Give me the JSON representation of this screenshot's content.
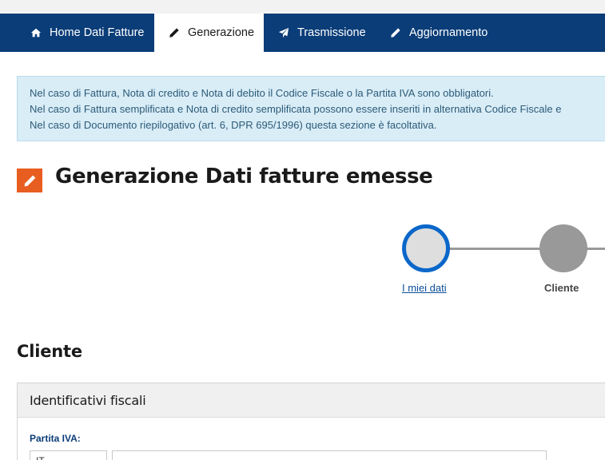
{
  "nav": {
    "tabs": [
      {
        "label": "Home Dati Fatture",
        "icon": "home-icon"
      },
      {
        "label": "Generazione",
        "icon": "pencil-icon",
        "active": true
      },
      {
        "label": "Trasmissione",
        "icon": "paper-plane-icon"
      },
      {
        "label": "Aggiornamento",
        "icon": "pencil-icon"
      }
    ]
  },
  "alert": {
    "lines": [
      "Nel caso di Fattura, Nota di credito e Nota di debito il Codice Fiscale o la Partita IVA sono obbligatori.",
      "Nel caso di Fattura semplificata e Nota di credito semplificata possono essere inseriti in alternativa Codice Fiscale e",
      "Nel caso di Documento riepilogativo (art. 6, DPR 695/1996) questa sezione è facoltativa."
    ]
  },
  "page": {
    "title": "Generazione Dati fatture emesse",
    "title_icon": "pencil-icon"
  },
  "steps": [
    {
      "label": "I miei dati",
      "state": "current"
    },
    {
      "label": "Cliente",
      "state": "pending"
    }
  ],
  "section": {
    "title": "Cliente"
  },
  "panel": {
    "title": "Identificativi fiscali",
    "fields": {
      "partita_iva_label": "Partita IVA:",
      "country_value": "IT",
      "partita_iva_value": ""
    }
  },
  "colors": {
    "navbar": "#0b3d78",
    "accent_orange": "#e85d20",
    "step_active_border": "#0b67c9",
    "alert_bg": "#d9edf7",
    "alert_text": "#2c5b78"
  }
}
